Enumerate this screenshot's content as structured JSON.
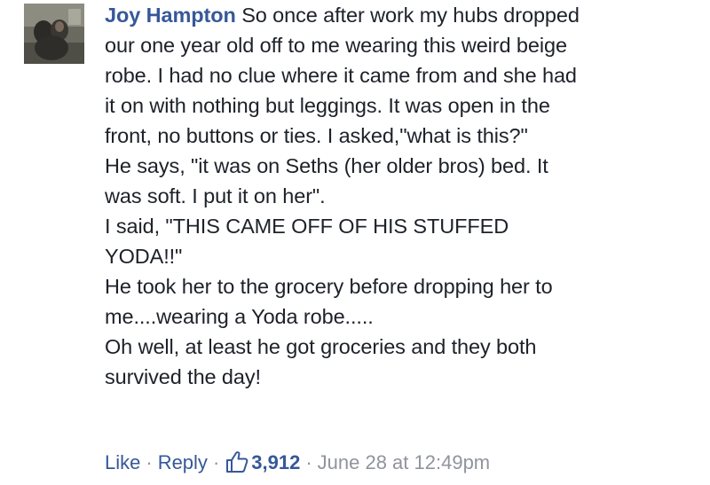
{
  "comment": {
    "author": "Joy Hampton",
    "first_line_rest": "So once after work my hubs dropped",
    "lines": [
      "our one year old off to me wearing this weird beige",
      "robe. I had no clue where it came from and she had",
      "it on with nothing but leggings. It was open in the",
      "front, no buttons or ties. I asked,\"what is this?\"",
      "He says, \"it was on Seths (her older bros) bed. It",
      "was soft. I put it on her\".",
      "I said, \"THIS CAME OFF OF HIS STUFFED",
      "YODA!!\"",
      "He took her to the grocery before dropping her to",
      "me....wearing a Yoda robe.....",
      "Oh well, at least he got groceries and they both",
      "survived the day!"
    ]
  },
  "actions": {
    "like_label": "Like",
    "reply_label": "Reply",
    "separator": "·",
    "like_count": "3,912",
    "timestamp": "June 28 at 12:49pm",
    "like_icon": "thumbs-up-icon"
  },
  "colors": {
    "link": "#365899",
    "text": "#1d2129",
    "muted": "#90949c"
  }
}
